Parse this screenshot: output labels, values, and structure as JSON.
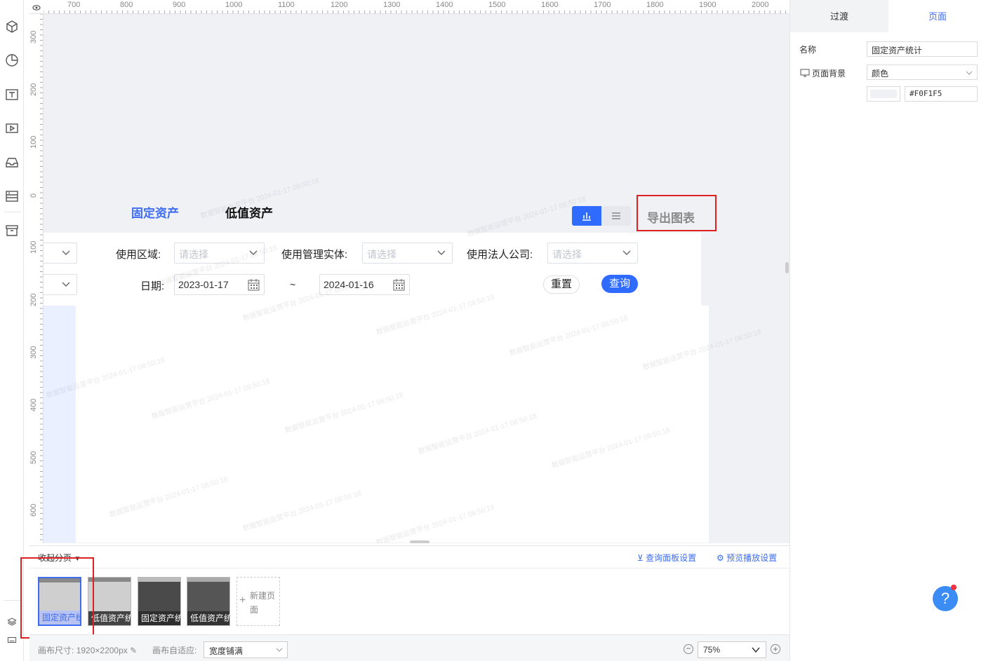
{
  "rulers": {
    "top_ticks": [
      "700",
      "800",
      "900",
      "1000",
      "1100",
      "1200",
      "1300",
      "1400",
      "1500",
      "1600",
      "1700",
      "1800",
      "1900",
      "2000"
    ],
    "left_ticks": [
      "300",
      "200",
      "100",
      "0",
      "100",
      "200",
      "300",
      "400",
      "500",
      "600"
    ]
  },
  "canvas": {
    "tabs": {
      "fixed_assets": "固定资产",
      "low_value_assets": "低值资产"
    },
    "export_button": "导出图表",
    "filters": {
      "use_area_label": "使用区域:",
      "use_entity_label": "使用管理实体:",
      "legal_company_label": "使用法人公司:",
      "placeholder": "请选择",
      "date_label": "日期:",
      "date_start": "2023-01-17",
      "date_sep": "~",
      "date_end": "2024-01-16",
      "reset_button": "重置",
      "query_button": "查询"
    },
    "watermark": "数据智能运营平台 2024-01-17 08:50:18"
  },
  "pages_bar": {
    "collapse_label": "收起分页",
    "query_panel_settings": "查询面板设置",
    "preview_settings": "预览播放设置",
    "pages": [
      {
        "label": "固定资产统计",
        "theme": "light",
        "selected": true
      },
      {
        "label": "低值资产统计",
        "theme": "light",
        "selected": false
      },
      {
        "label": "固定资产统计",
        "theme": "dark",
        "selected": false
      },
      {
        "label": "低值资产统计",
        "theme": "dark",
        "selected": false
      }
    ],
    "new_page_label": "新建页面"
  },
  "statusbar": {
    "canvas_size_label": "画布尺寸:",
    "canvas_size_value": "1920×2200px",
    "canvas_fit_label": "画布自适应:",
    "canvas_fit_value": "宽度铺满",
    "zoom_value": "75%"
  },
  "right_panel": {
    "tabs": {
      "transition": "过渡",
      "page": "页面"
    },
    "name_label": "名称",
    "name_value": "固定资产统计",
    "background_label": "页面背景",
    "background_type": "颜色",
    "background_color": "#F0F1F5"
  },
  "colors": {
    "accent": "#2f6bff",
    "highlight_box": "#e02020",
    "canvas_bg": "#F0F1F5"
  }
}
